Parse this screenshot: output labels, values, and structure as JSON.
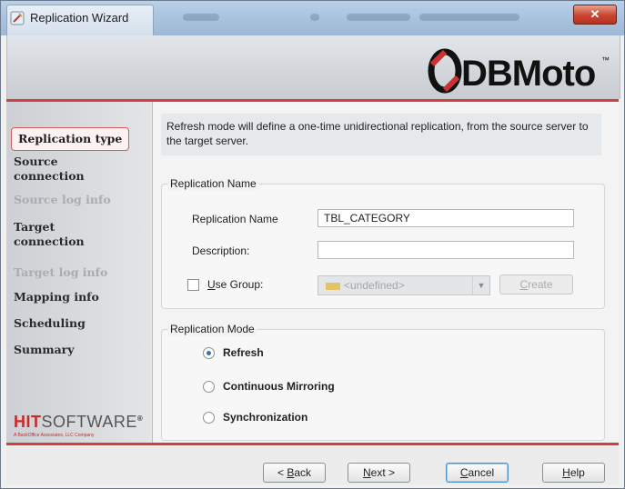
{
  "window": {
    "title": "Replication Wizard",
    "close_glyph": "✕"
  },
  "banner": {
    "logo_text": "DBMoto",
    "logo_tm": "™"
  },
  "sidebar": {
    "steps": [
      {
        "label": "Replication type",
        "state": "active"
      },
      {
        "label": "Source connection",
        "state": "enabled"
      },
      {
        "label": "Source log info",
        "state": "disabled"
      },
      {
        "label": "Target connection",
        "state": "enabled"
      },
      {
        "label": "Target log info",
        "state": "disabled"
      },
      {
        "label": "Mapping info",
        "state": "enabled"
      },
      {
        "label": "Scheduling",
        "state": "enabled"
      },
      {
        "label": "Summary",
        "state": "enabled"
      }
    ],
    "vendor_logo_hit": "HIT",
    "vendor_logo_software": "SOFTWARE",
    "vendor_logo_reg": "®",
    "vendor_tagline": "A BackOffice Associates, LLC Company"
  },
  "intro": {
    "text": "Refresh mode will define a one-time unidirectional replication, from the source server to the target server."
  },
  "replication_name_group": {
    "title": "Replication Name",
    "name_label": "Replication Name",
    "name_value": "TBL_CATEGORY",
    "description_label": "Description:",
    "description_value": "",
    "use_group_label_underlined": "U",
    "use_group_label_rest": "se Group:",
    "use_group_checked": false,
    "group_value": "<undefined>",
    "create_label_underlined": "C",
    "create_label_rest": "reate"
  },
  "replication_mode_group": {
    "title": "Replication Mode",
    "options": [
      {
        "label": "Refresh",
        "checked": true
      },
      {
        "label": "Continuous Mirroring",
        "checked": false
      },
      {
        "label": "Synchronization",
        "checked": false
      }
    ]
  },
  "footer": {
    "back": {
      "prefix": "< ",
      "underlined": "B",
      "rest": "ack"
    },
    "next": {
      "underlined": "N",
      "rest": "ext >"
    },
    "cancel": {
      "underlined": "C",
      "rest": "ancel"
    },
    "help": {
      "underlined": "H",
      "rest": "elp"
    }
  },
  "colors": {
    "accent_red": "#d04040",
    "active_step_border": "#d55a5a",
    "radio_dot": "#3a6fb0"
  }
}
